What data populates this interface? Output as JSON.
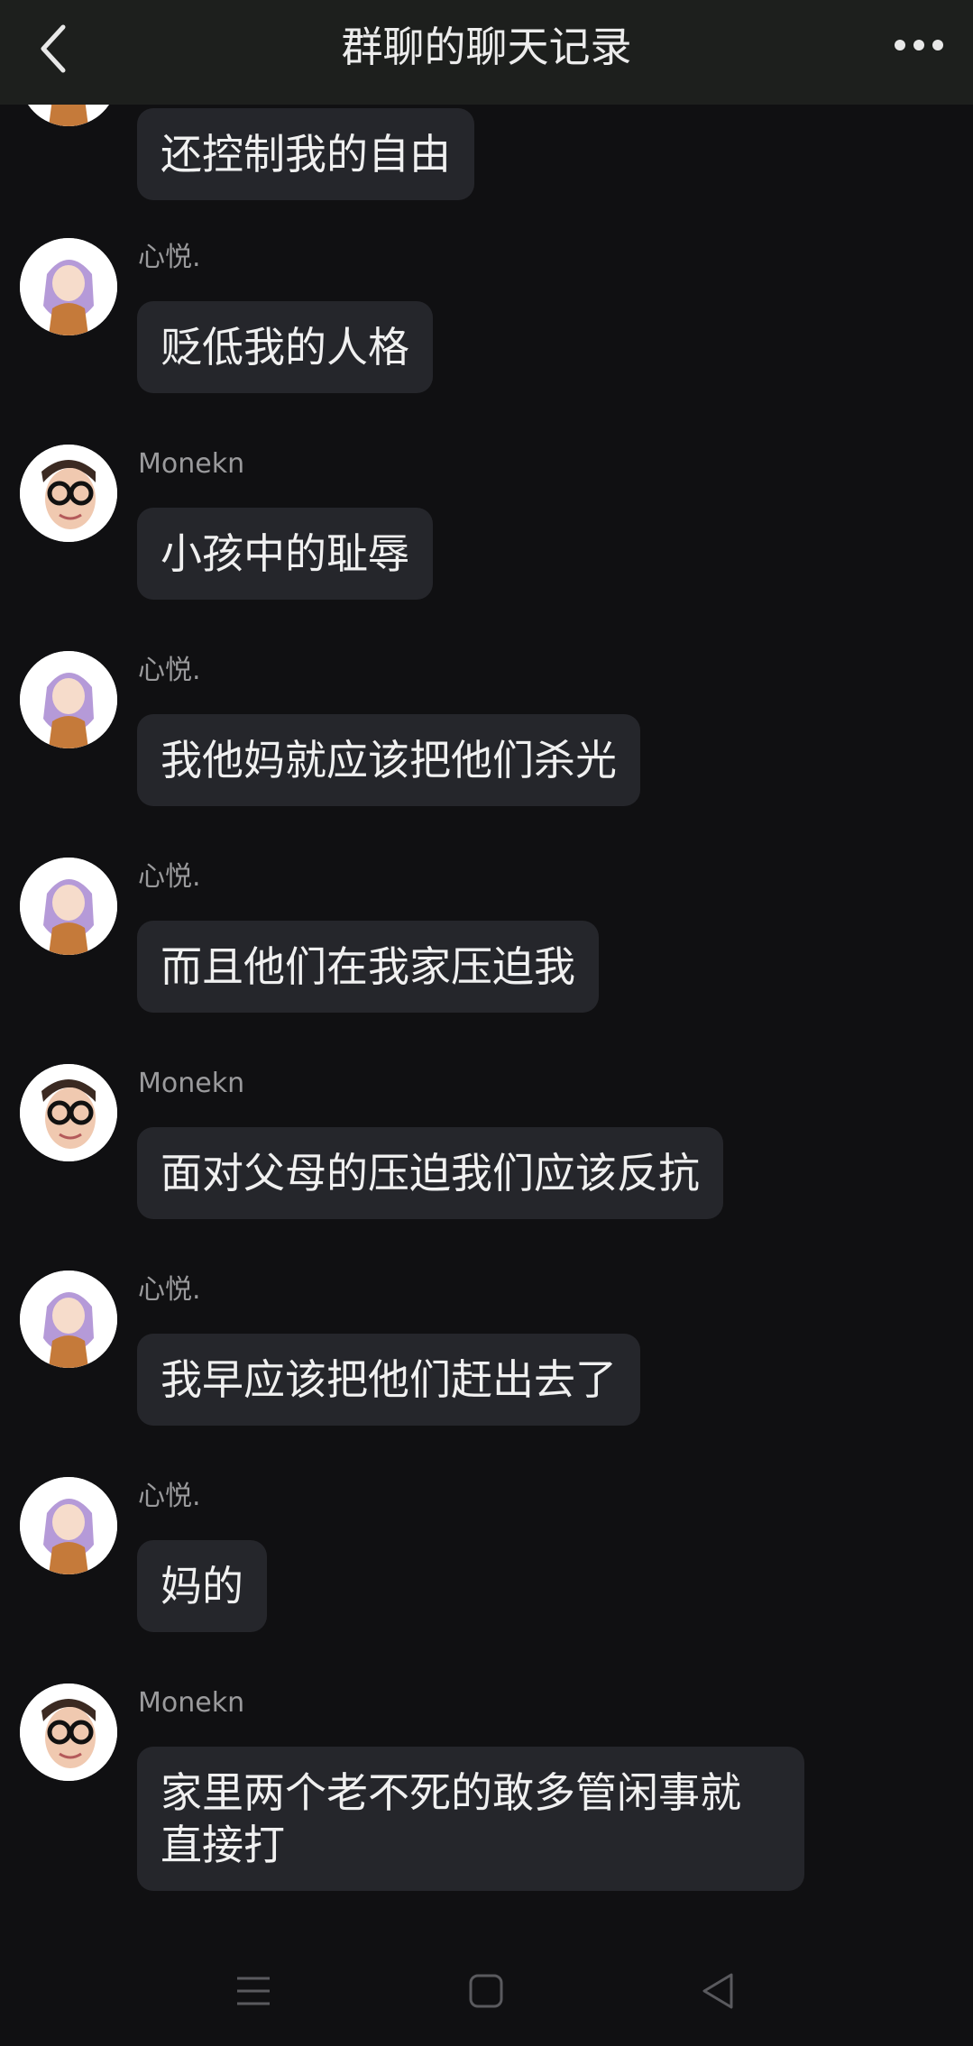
{
  "header": {
    "title": "群聊的聊天记录",
    "back_icon": "chevron-left-icon",
    "more_icon": "more-horizontal-icon"
  },
  "messages": [
    {
      "sender": "",
      "text": "还控制我的自由",
      "avatar": "anime-girl-avatar"
    },
    {
      "sender": "心悦.",
      "text": "贬低我的人格",
      "avatar": "anime-girl-avatar"
    },
    {
      "sender": "Monekn",
      "text": "小孩中的耻辱",
      "avatar": "boy-glasses-avatar"
    },
    {
      "sender": "心悦.",
      "text": "我他妈就应该把他们杀光",
      "avatar": "anime-girl-avatar"
    },
    {
      "sender": "心悦.",
      "text": "而且他们在我家压迫我",
      "avatar": "anime-girl-avatar"
    },
    {
      "sender": "Monekn",
      "text": "面对父母的压迫我们应该反抗",
      "avatar": "boy-glasses-avatar"
    },
    {
      "sender": "心悦.",
      "text": "我早应该把他们赶出去了",
      "avatar": "anime-girl-avatar"
    },
    {
      "sender": "心悦.",
      "text": "妈的",
      "avatar": "anime-girl-avatar"
    },
    {
      "sender": "Monekn",
      "text": "家里两个老不死的敢多管闲事就直接打",
      "avatar": "boy-glasses-avatar"
    }
  ],
  "navbar": {
    "menu_icon": "menu-icon",
    "home_icon": "square-home-icon",
    "back_icon": "triangle-back-icon"
  },
  "colors": {
    "background": "#101012",
    "header": "#1d1f1d",
    "bubble": "#25262b",
    "text": "#f0f0f0",
    "sender": "#9a9a9c"
  }
}
